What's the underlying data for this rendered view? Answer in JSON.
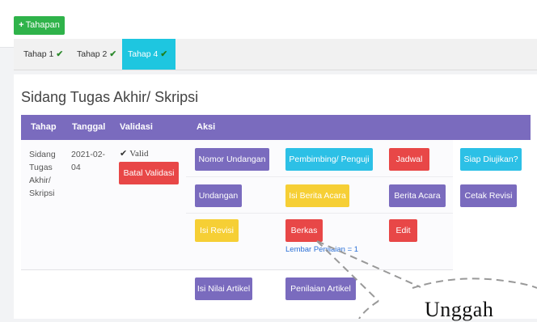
{
  "toolbar": {
    "add_label": "Tahapan",
    "add_icon": "+"
  },
  "tabs": [
    {
      "label": "Tahap 1",
      "check": "✔"
    },
    {
      "label": "Tahap 2",
      "check": "✔"
    },
    {
      "label": "Tahap 4",
      "check": "✔"
    }
  ],
  "page_title": "Sidang Tugas Akhir/ Skripsi",
  "table": {
    "headers": [
      "Tahap",
      "Tanggal",
      "Validasi",
      "Aksi"
    ],
    "row": {
      "tahap_lines": [
        "Sidang",
        "Tugas",
        "Akhir/",
        "Skripsi"
      ],
      "tanggal_lines": [
        "2021-02-",
        "04"
      ],
      "validasi_icon": "✔",
      "validasi_text": "Valid",
      "batal_label": "Batal Validasi"
    }
  },
  "actions": {
    "nomor_undangan": "Nomor Undangan",
    "pembimbing_penguji": "Pembimbing/ Penguji",
    "jadwal": "Jadwal",
    "siap_diujikan": "Siap Diujikan?",
    "undangan": "Undangan",
    "isi_berita_acara": "Isi Berita Acara",
    "berita_acara": "Berita Acara",
    "cetak_revisi": "Cetak Revisi",
    "isi_revisi": "Isi Revisi",
    "berkas": "Berkas",
    "edit": "Edit",
    "lembar_penilaian": "Lembar Penilaian = 1",
    "isi_nilai_artikel": "Isi Nilai Artikel",
    "penilaian_artikel": "Penilaian Artikel"
  },
  "callout": {
    "text": "Unggah"
  },
  "colors": {
    "purple": "#7a6bbe",
    "cyan": "#2cc0e6",
    "red": "#e84747",
    "yellow": "#f6cf35",
    "green": "#2fb34a",
    "active_tab": "#1ec6e0"
  }
}
